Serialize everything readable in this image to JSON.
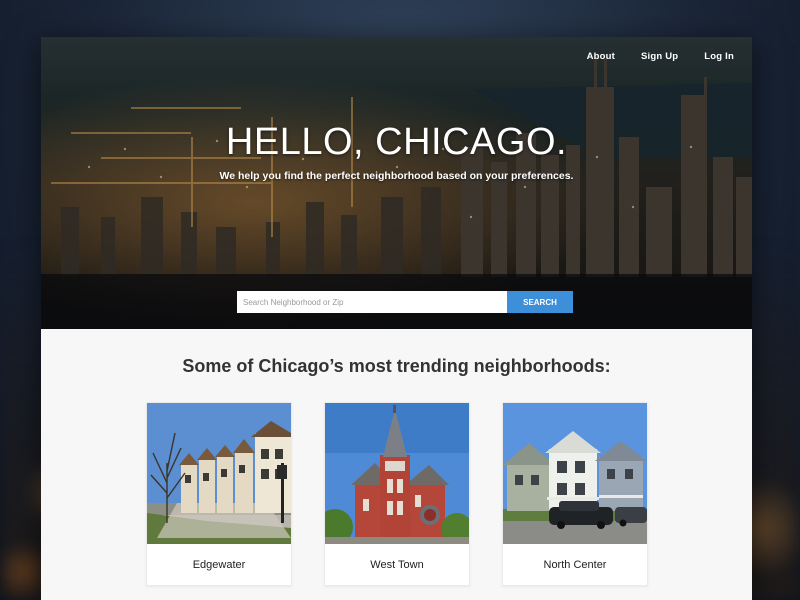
{
  "nav": {
    "items": [
      {
        "label": "About"
      },
      {
        "label": "Sign Up"
      },
      {
        "label": "Log In"
      }
    ]
  },
  "hero": {
    "title": "HELLO, CHICAGO.",
    "subtitle": "We help you find the perfect neighborhood based on your preferences."
  },
  "search": {
    "placeholder": "Search Neighborhood or Zip",
    "button_label": "SEARCH"
  },
  "section": {
    "title": "Some of Chicago’s most trending neighborhoods:"
  },
  "neighborhoods": [
    {
      "name": "Edgewater",
      "image": "rowhouses-photo"
    },
    {
      "name": "West Town",
      "image": "church-photo"
    },
    {
      "name": "North Center",
      "image": "houses-with-car-photo"
    }
  ],
  "colors": {
    "accent": "#3d8fd9",
    "page_background": "#f7f7f7",
    "text": "#333333"
  }
}
